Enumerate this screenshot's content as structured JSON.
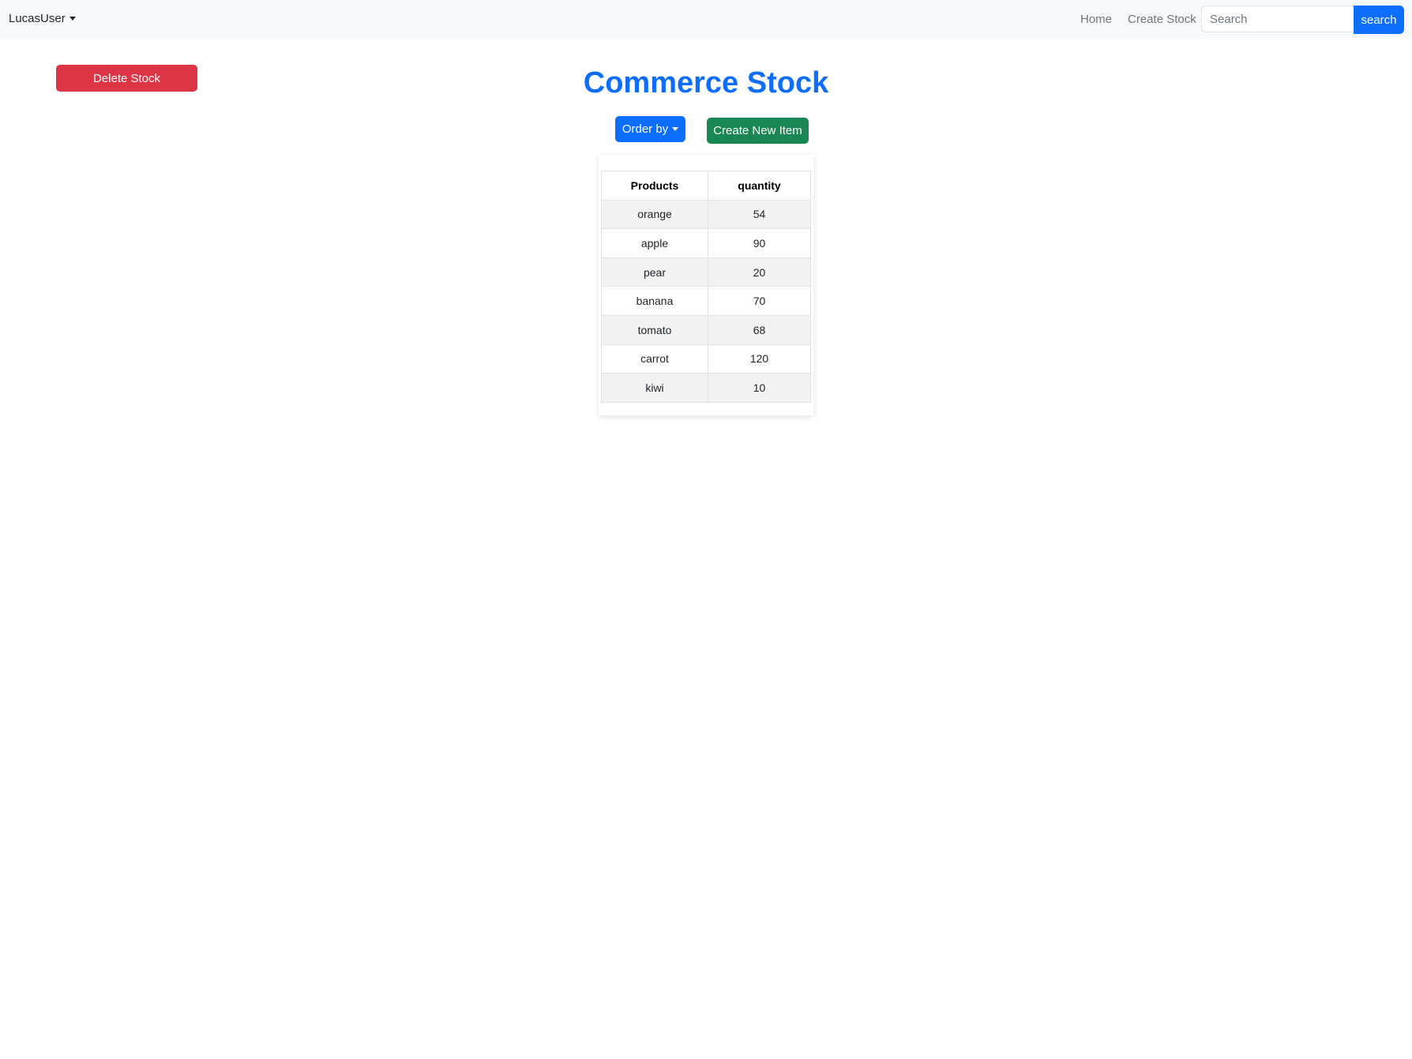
{
  "navbar": {
    "user": "LucasUser",
    "links": [
      {
        "label": "Home"
      },
      {
        "label": "Create Stock"
      }
    ],
    "search": {
      "placeholder": "Search",
      "value": "",
      "button_label": "search"
    }
  },
  "actions": {
    "delete_label": "Delete Stock",
    "order_label": "Order by",
    "create_label": "Create New Item"
  },
  "title": "Commerce Stock",
  "table": {
    "headers": [
      "Products",
      "quantity"
    ],
    "rows": [
      {
        "product": "orange",
        "quantity": "54"
      },
      {
        "product": "apple",
        "quantity": "90"
      },
      {
        "product": "pear",
        "quantity": "20"
      },
      {
        "product": "banana",
        "quantity": "70"
      },
      {
        "product": "tomato",
        "quantity": "68"
      },
      {
        "product": "carrot",
        "quantity": "120"
      },
      {
        "product": "kiwi",
        "quantity": "10"
      }
    ]
  },
  "colors": {
    "primary": "#0d6efd",
    "danger": "#dc3545",
    "success": "#198754",
    "navbar_bg": "#f8f9fa"
  }
}
